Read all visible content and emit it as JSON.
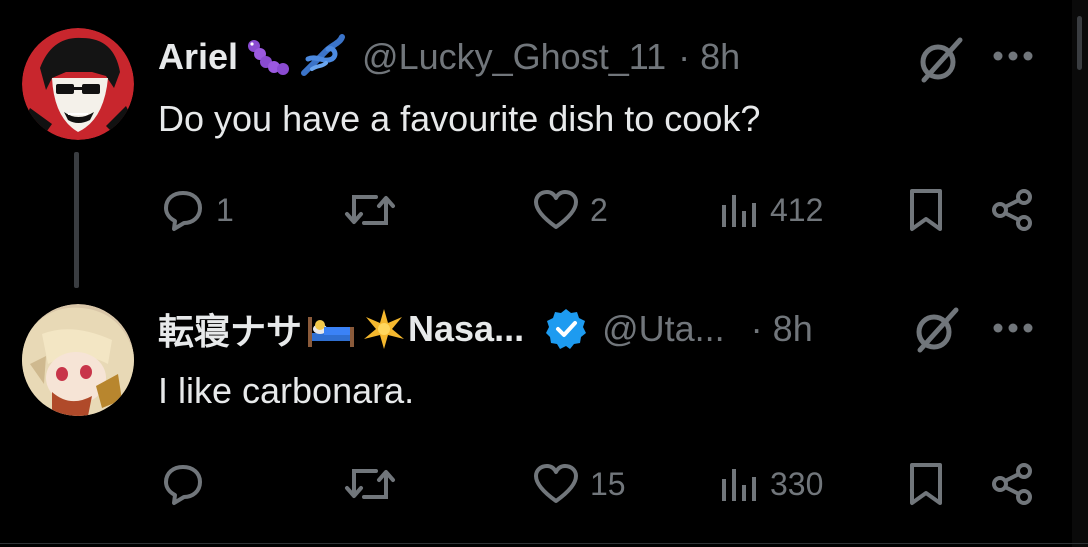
{
  "colors": {
    "background": "#000000",
    "text": "#e7e9ea",
    "muted": "#71767b",
    "verified": "#1d9bf0"
  },
  "posts": [
    {
      "name": "Ariel",
      "handle": "@Lucky_Ghost_11",
      "separator": "·",
      "time": "8h",
      "text": "Do you have a favourite dish to cook?",
      "replies": "1",
      "reposts": "",
      "likes": "2",
      "views": "412"
    },
    {
      "name": "転寝ナサ",
      "name_suffix": "Nasa...",
      "handle": "@Uta...",
      "separator": "·",
      "time": "8h",
      "text": "I like carbonara.",
      "replies": "",
      "reposts": "",
      "likes": "15",
      "views": "330",
      "verified": true
    }
  ]
}
